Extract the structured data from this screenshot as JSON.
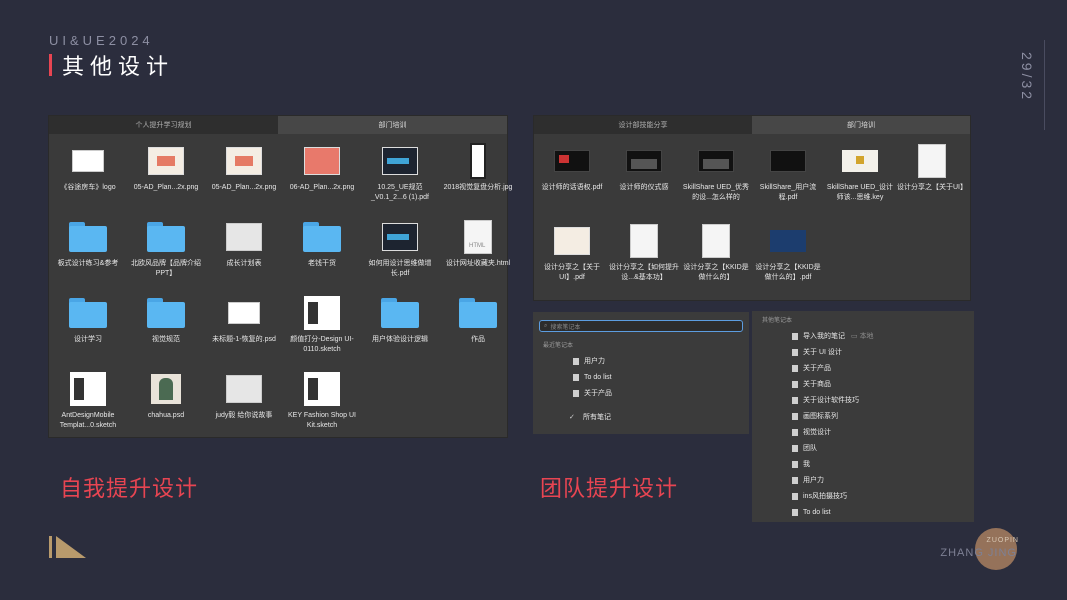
{
  "header": {
    "subtitle": "UI&UE2024",
    "title": "其他设计",
    "page_number": "29/32"
  },
  "finder_left": {
    "tabs": [
      "个人提升学习规划",
      "部门培训"
    ],
    "files": [
      {
        "name": "《谷途房车》logo",
        "icon": "image-thumbnail-icon"
      },
      {
        "name": "05-AD_Plan...2x.png",
        "icon": "image-thumbnail-icon"
      },
      {
        "name": "05-AD_Plan...2x.png",
        "icon": "image-thumbnail-icon"
      },
      {
        "name": "06-AD_Plan...2x.png",
        "icon": "image-thumbnail-icon"
      },
      {
        "name": "10.25_UE规范_V0.1_2...6 (1).pdf",
        "icon": "pdf-thumbnail-icon"
      },
      {
        "name": "2018视觉复盘分析.jpg",
        "icon": "image-thumbnail-icon"
      },
      {
        "name": "板式设计练习&参考",
        "icon": "folder-icon"
      },
      {
        "name": "北欧风品牌【品牌介绍PPT】",
        "icon": "folder-icon"
      },
      {
        "name": "成长计划表",
        "icon": "spreadsheet-thumbnail-icon"
      },
      {
        "name": "老钱干货",
        "icon": "folder-icon"
      },
      {
        "name": "如何用设计思维做增长.pdf",
        "icon": "pdf-thumbnail-icon"
      },
      {
        "name": "设计网址收藏夹.html",
        "icon": "html-file-icon"
      },
      {
        "name": "设计学习",
        "icon": "folder-icon"
      },
      {
        "name": "视觉规范",
        "icon": "folder-icon"
      },
      {
        "name": "未标题-1-恢复的.psd",
        "icon": "psd-thumbnail-icon"
      },
      {
        "name": "颜值打分-Design UI-0110.sketch",
        "icon": "sketch-thumbnail-icon"
      },
      {
        "name": "用户体验设计逻辑",
        "icon": "folder-icon"
      },
      {
        "name": "作品",
        "icon": "folder-icon"
      },
      {
        "name": "AntDesignMobile Templat...0.sketch",
        "icon": "sketch-thumbnail-icon"
      },
      {
        "name": "chahua.psd",
        "icon": "psd-thumbnail-icon"
      },
      {
        "name": "judy毅 给你说故事",
        "icon": "image-thumbnail-icon"
      },
      {
        "name": "KEY Fashion Shop UI Kit.sketch",
        "icon": "sketch-thumbnail-icon"
      }
    ]
  },
  "finder_right": {
    "tabs": [
      "设计部技能分享",
      "部门培训"
    ],
    "files": [
      {
        "name": "设计师的话语权.pdf",
        "icon": "pdf-thumbnail-icon"
      },
      {
        "name": "设计师的仪式感",
        "icon": "pdf-thumbnail-icon"
      },
      {
        "name": "SkillShare UED_优秀的设...怎么样的",
        "icon": "pdf-thumbnail-icon"
      },
      {
        "name": "SkillShare_用户流程.pdf",
        "icon": "pdf-thumbnail-icon"
      },
      {
        "name": "SkillShare UED_设计师该...思维.key",
        "icon": "keynote-thumbnail-icon"
      },
      {
        "name": "设计分享之【关于UI】",
        "icon": "pdf-thumbnail-icon"
      },
      {
        "name": "设计分享之【关于UI】.pdf",
        "icon": "pdf-thumbnail-icon"
      },
      {
        "name": "设计分享之【如何提升设...&基本功】",
        "icon": "pdf-thumbnail-icon"
      },
      {
        "name": "设计分享之【KKID是做什么的】",
        "icon": "pdf-thumbnail-icon"
      },
      {
        "name": "设计分享之【KKID是做什么的】.pdf",
        "icon": "pdf-thumbnail-icon"
      }
    ]
  },
  "notes_a": {
    "search_placeholder": "搜索笔记本",
    "section_label": "最近笔记本",
    "items": [
      "用户力",
      "To do list",
      "关于产品"
    ],
    "all_notes": "所有笔记"
  },
  "notes_b": {
    "section_label": "其他笔记本",
    "items": [
      "导入我的笔记",
      "关于 UI 设计",
      "关于产品",
      "关于商品",
      "关于设计软件技巧",
      "画图标系列",
      "视觉设计",
      "团队",
      "我",
      "用户力",
      "ins风拍摄技巧",
      "To do list"
    ],
    "local_tag": "本地"
  },
  "headings": {
    "left": "自我提升设计",
    "right": "团队提升设计"
  },
  "footer": {
    "signature_top": "ZUOPIN",
    "signature_name": "ZHANG JING"
  },
  "colors": {
    "background": "#2b2d3d",
    "accent_red": "#e84552",
    "gold": "#b89a6c"
  }
}
